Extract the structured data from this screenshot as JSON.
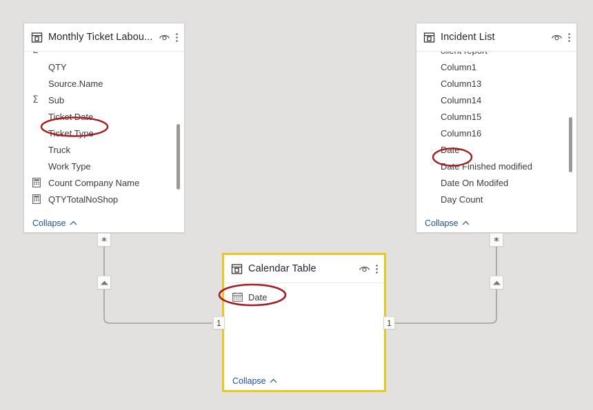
{
  "canvas": {
    "background": "#e3e1df",
    "selection_color": "#e8c81e",
    "annotation_color": "#a51c21",
    "link_color": "#1f4e9c"
  },
  "tables": [
    {
      "id": "monthly-ticket-labour",
      "title": "Monthly Ticket Labou...",
      "selected": false,
      "header_icons": [
        "eye-icon",
        "more-options-icon"
      ],
      "collapse_label": "Collapse",
      "clipped_top_row": true,
      "fields": [
        {
          "label": "QTY",
          "icon": "none"
        },
        {
          "label": "Source.Name",
          "icon": "none"
        },
        {
          "label": "Sub",
          "icon": "sigma"
        },
        {
          "label": "Ticket Date",
          "icon": "none",
          "annotated": true
        },
        {
          "label": "Ticket Type",
          "icon": "none"
        },
        {
          "label": "Truck",
          "icon": "none"
        },
        {
          "label": "Work Type",
          "icon": "none"
        },
        {
          "label": "Count Company Name",
          "icon": "measure"
        },
        {
          "label": "QTYTotalNoShop",
          "icon": "measure"
        }
      ]
    },
    {
      "id": "incident-list",
      "title": "Incident List",
      "selected": false,
      "header_icons": [
        "eye-icon",
        "more-options-icon"
      ],
      "collapse_label": "Collapse",
      "clipped_top_row": true,
      "clipped_top_label": "client report",
      "fields": [
        {
          "label": "Column1",
          "icon": "none"
        },
        {
          "label": "Column13",
          "icon": "none"
        },
        {
          "label": "Column14",
          "icon": "none"
        },
        {
          "label": "Column15",
          "icon": "none"
        },
        {
          "label": "Column16",
          "icon": "none"
        },
        {
          "label": "Date",
          "icon": "none",
          "annotated": true
        },
        {
          "label": "Date Finished modified",
          "icon": "none"
        },
        {
          "label": "Date On Modifed",
          "icon": "none"
        },
        {
          "label": "Day Count",
          "icon": "none"
        }
      ]
    },
    {
      "id": "calendar-table",
      "title": "Calendar Table",
      "selected": true,
      "header_icons": [
        "eye-icon",
        "more-options-icon"
      ],
      "collapse_label": "Collapse",
      "clipped_top_row": false,
      "fields": [
        {
          "label": "Date",
          "icon": "calendar",
          "annotated": true
        }
      ]
    }
  ],
  "relationships": [
    {
      "id": "monthly-to-calendar",
      "from_table": "monthly-ticket-labour",
      "to_table": "calendar-table",
      "from_cardinality": "*",
      "to_cardinality": "1",
      "cross_filter": "single"
    },
    {
      "id": "incident-to-calendar",
      "from_table": "incident-list",
      "to_table": "calendar-table",
      "from_cardinality": "*",
      "to_cardinality": "1",
      "cross_filter": "single"
    }
  ]
}
